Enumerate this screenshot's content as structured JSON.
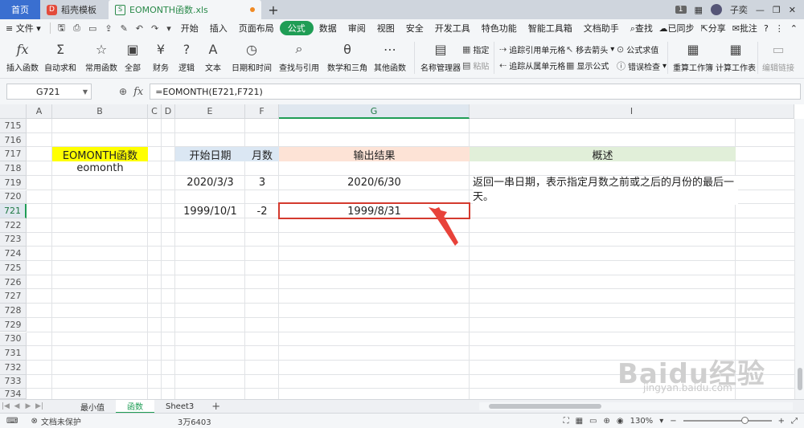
{
  "titlebar": {
    "home_tab": "首页",
    "template_tab": "稻壳模板",
    "doc_tab": "EOMONTH函数.xls",
    "new_tab": "+",
    "page_badge": "1",
    "user_name": "子奕"
  },
  "menubar": {
    "file": "文件",
    "items": [
      "开始",
      "插入",
      "页面布局",
      "公式",
      "数据",
      "审阅",
      "视图",
      "安全",
      "开发工具",
      "特色功能",
      "智能工具箱",
      "文档助手"
    ],
    "active_index": 3,
    "search": "查找",
    "sync": "已同步",
    "share": "分享",
    "comment": "批注"
  },
  "ribbon": {
    "big_buttons": [
      "插入函数",
      "自动求和",
      "常用函数",
      "全部",
      "财务",
      "逻辑",
      "文本",
      "日期和时间",
      "查找与引用",
      "数学和三角",
      "其他函数",
      "名称管理器",
      "重算工作簿",
      "计算工作表",
      "编辑链接"
    ],
    "small_buttons": [
      "指定",
      "粘贴",
      "追踪引用单元格",
      "追踪从属单元格",
      "移去箭头",
      "显示公式",
      "公式求值",
      "错误检查"
    ]
  },
  "formulabar": {
    "name_box": "G721",
    "fx": "fx",
    "formula": "=EOMONTH(E721,F721)"
  },
  "grid": {
    "columns": [
      "A",
      "B",
      "C",
      "D",
      "E",
      "F",
      "G",
      "I"
    ],
    "selected_column": "G",
    "rows": [
      "715",
      "716",
      "717",
      "718",
      "719",
      "720",
      "721",
      "722",
      "723",
      "724",
      "725",
      "726",
      "727",
      "728",
      "729",
      "730",
      "731",
      "732",
      "733",
      "734"
    ],
    "selected_row": "721",
    "cells": {
      "b717": "EOMONTH函数",
      "b718": "eomonth",
      "e717": "开始日期",
      "f717": "月数",
      "g717": "输出结果",
      "i717": "概述",
      "e719": "2020/3/3",
      "f719": "3",
      "g719": "2020/6/30",
      "i719": "返回一串日期，表示指定月数之前或之后的月份的最后一天。",
      "e721": "1999/10/1",
      "f721": "-2",
      "g721": "1999/8/31"
    },
    "colors": {
      "yellow": "#ffff00",
      "blue_header": "#dbe7f3",
      "salmon_header": "#fde3d6",
      "green_header": "#e1efd9",
      "selection": "#d43a2e",
      "arrow": "#e8423a"
    }
  },
  "sheets": {
    "tabs": [
      "最小值",
      "函数",
      "Sheet3"
    ],
    "active": "函数",
    "add": "+"
  },
  "statusbar": {
    "protect": "文档未保护",
    "sum": "3万6403",
    "zoom": "130%"
  },
  "watermark": {
    "logo": "Baidu经验",
    "url": "jingyan.baidu.com"
  }
}
